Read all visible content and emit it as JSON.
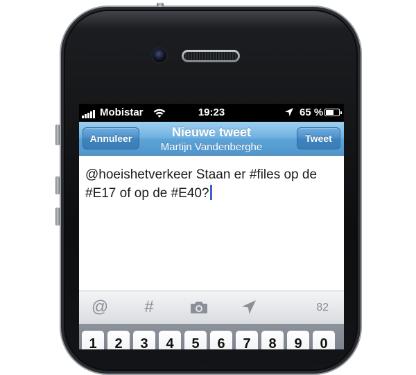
{
  "status_bar": {
    "carrier": "Mobistar",
    "time": "19:23",
    "battery_percent": "65 %",
    "signal_icon": "signal-bars-icon",
    "wifi_icon": "wifi-icon",
    "location_icon": "location-arrow-icon",
    "battery_icon": "battery-icon",
    "battery_level": 0.65
  },
  "navbar": {
    "cancel_label": "Annuleer",
    "title": "Nieuwe tweet",
    "subtitle": "Martijn Vandenberghe",
    "tweet_label": "Tweet",
    "colors": {
      "bar": "#5ca3d7",
      "button": "#3f84bf"
    }
  },
  "compose": {
    "text": "@hoeishetverkeer Staan er #files op de #E17 of op de #E40?",
    "cursor_color": "#3b62c9"
  },
  "accessory_bar": {
    "icons": [
      {
        "name": "mention-icon",
        "glyph": "@"
      },
      {
        "name": "hashtag-icon",
        "glyph": "#"
      },
      {
        "name": "camera-icon",
        "glyph": ""
      },
      {
        "name": "location-icon",
        "glyph": ""
      }
    ],
    "char_count": "82"
  },
  "keyboard": {
    "keys": [
      "1",
      "2",
      "3",
      "4",
      "5",
      "6",
      "7",
      "8",
      "9",
      "0"
    ]
  }
}
